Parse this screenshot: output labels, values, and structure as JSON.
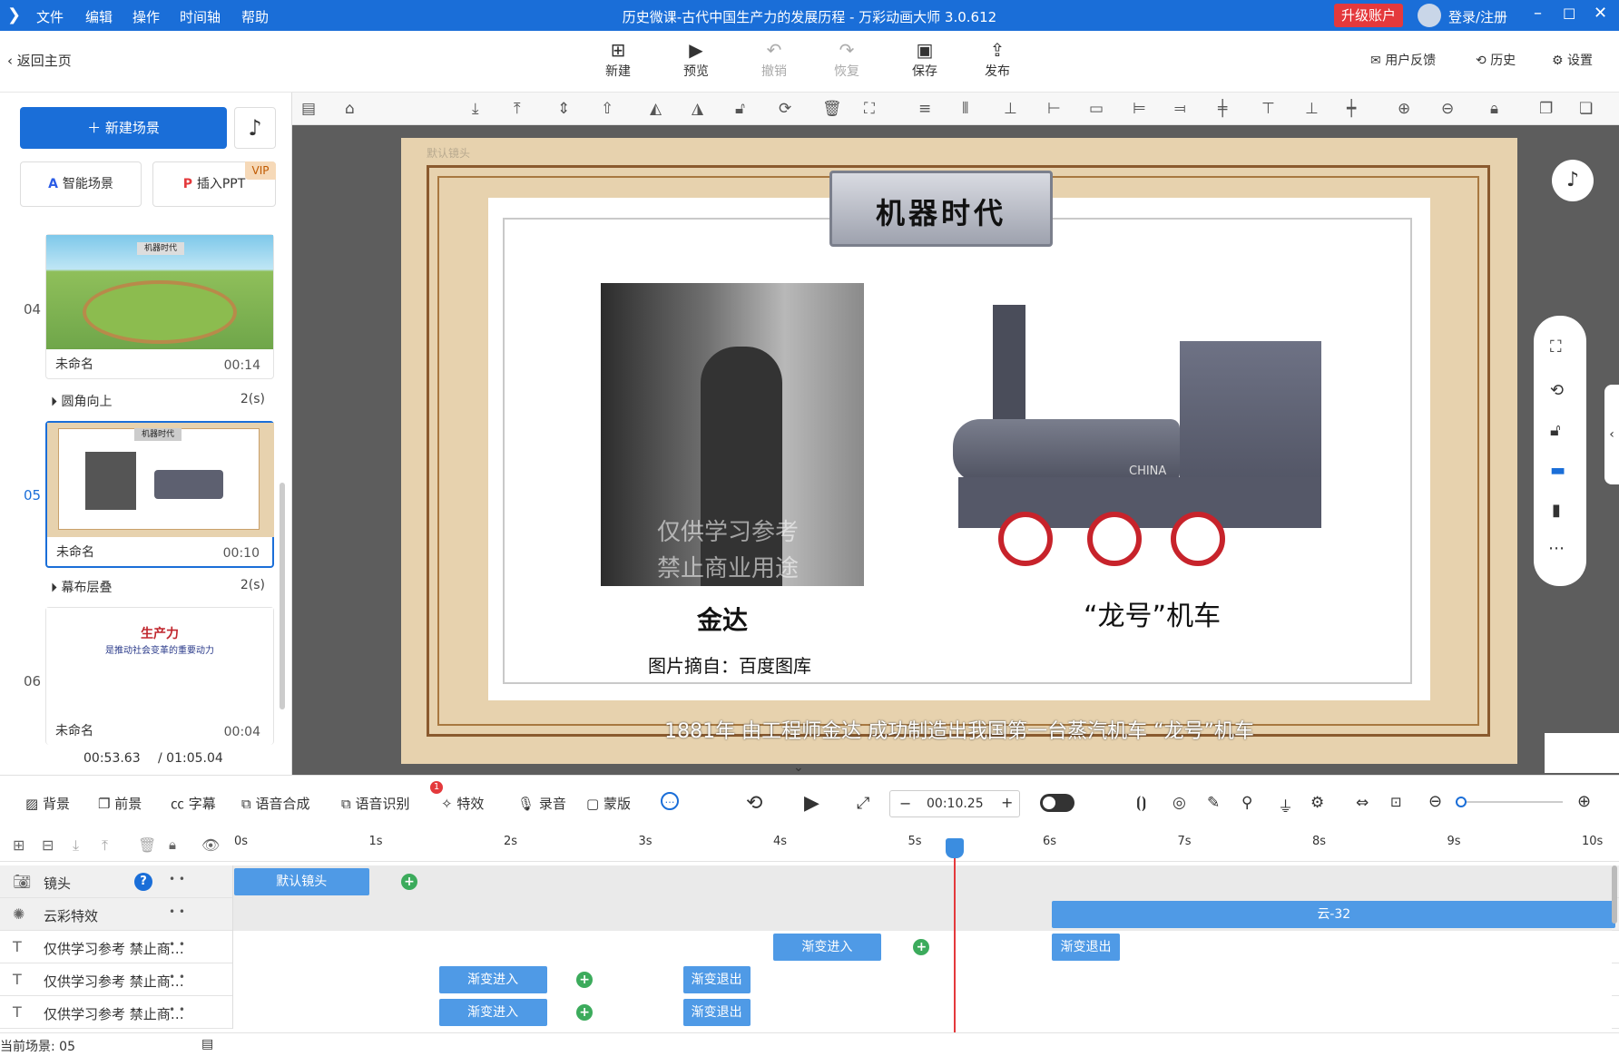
{
  "titlebar": {
    "menu": [
      "文件",
      "编辑",
      "操作",
      "时间轴",
      "帮助"
    ],
    "title": "历史微课-古代中国生产力的发展历程 - 万彩动画大师 3.0.612",
    "upgrade": "升级账户",
    "login": "登录/注册"
  },
  "toolbar": {
    "back": "返回主页",
    "new": "新建",
    "preview": "预览",
    "undo": "撤销",
    "redo": "恢复",
    "save": "保存",
    "publish": "发布",
    "feedback": "用户反馈",
    "history": "历史",
    "settings": "设置"
  },
  "left": {
    "new_scene": "新建场景",
    "smart_scene": "智能场景",
    "insert_ppt": "插入PPT",
    "vip": "VIP",
    "scenes": [
      {
        "index": "04",
        "name": "未命名",
        "duration": "00:14",
        "thumb_title": "机器时代"
      },
      {
        "index": "05",
        "name": "未命名",
        "duration": "00:10",
        "thumb_title": "机器时代"
      },
      {
        "index": "06",
        "name": "未命名",
        "duration": "00:04",
        "thumb_title": "生产力",
        "thumb_sub": "是推动社会变革的重要动力"
      }
    ],
    "transitions": [
      {
        "name": "圆角向上",
        "time": "2(s)"
      },
      {
        "name": "幕布层叠",
        "time": "2(s)"
      }
    ],
    "time_current": "00:53.63",
    "time_total": "/ 01:05.04"
  },
  "stage": {
    "camera_label": "默认镜头",
    "heading": "机器时代",
    "person_name": "金达",
    "source": "图片摘自：百度图库",
    "watermark_1": "仅供学习参考",
    "watermark_2": "禁止商业用途",
    "train_label": "“龙号”机车",
    "train_text": "CHINA",
    "caption": "1881年 由工程师金达 成功制造出我国第一台蒸汽机车 “龙号”机车"
  },
  "bottom": {
    "items": [
      "背景",
      "前景",
      "字幕",
      "语音合成",
      "语音识别",
      "特效",
      "录音",
      "蒙版"
    ],
    "badge": "1",
    "time": "00:10.25"
  },
  "timeline": {
    "ticks": [
      "0s",
      "1s",
      "2s",
      "3s",
      "4s",
      "5s",
      "6s",
      "7s",
      "8s",
      "9s",
      "10s"
    ],
    "playhead": 5.35,
    "tracks": [
      {
        "label": "镜头",
        "clips": [
          {
            "text": "默认镜头",
            "start": 0,
            "end": 1.0
          }
        ],
        "keys": [
          1.3
        ]
      },
      {
        "label": "云彩特效",
        "clips": [
          {
            "text": "云-32",
            "start": 6.07,
            "end": 10.25
          }
        ],
        "keys": []
      },
      {
        "label": "仅供学习参考 禁止商…",
        "clips": [
          {
            "text": "渐变进入",
            "start": 4.0,
            "end": 4.8
          },
          {
            "text": "渐变退出",
            "start": 6.07,
            "end": 6.57
          }
        ],
        "keys": [
          5.1
        ]
      },
      {
        "label": "仅供学习参考 禁止商…",
        "clips": [
          {
            "text": "渐变进入",
            "start": 1.52,
            "end": 2.32
          },
          {
            "text": "渐变退出",
            "start": 3.33,
            "end": 3.83
          }
        ],
        "keys": [
          2.6
        ]
      },
      {
        "label": "仅供学习参考 禁止商…",
        "clips": [
          {
            "text": "渐变进入",
            "start": 1.52,
            "end": 2.32
          },
          {
            "text": "渐变退出",
            "start": 3.33,
            "end": 3.83
          }
        ],
        "keys": [
          2.6
        ]
      }
    ],
    "status": "当前场景: 05"
  }
}
